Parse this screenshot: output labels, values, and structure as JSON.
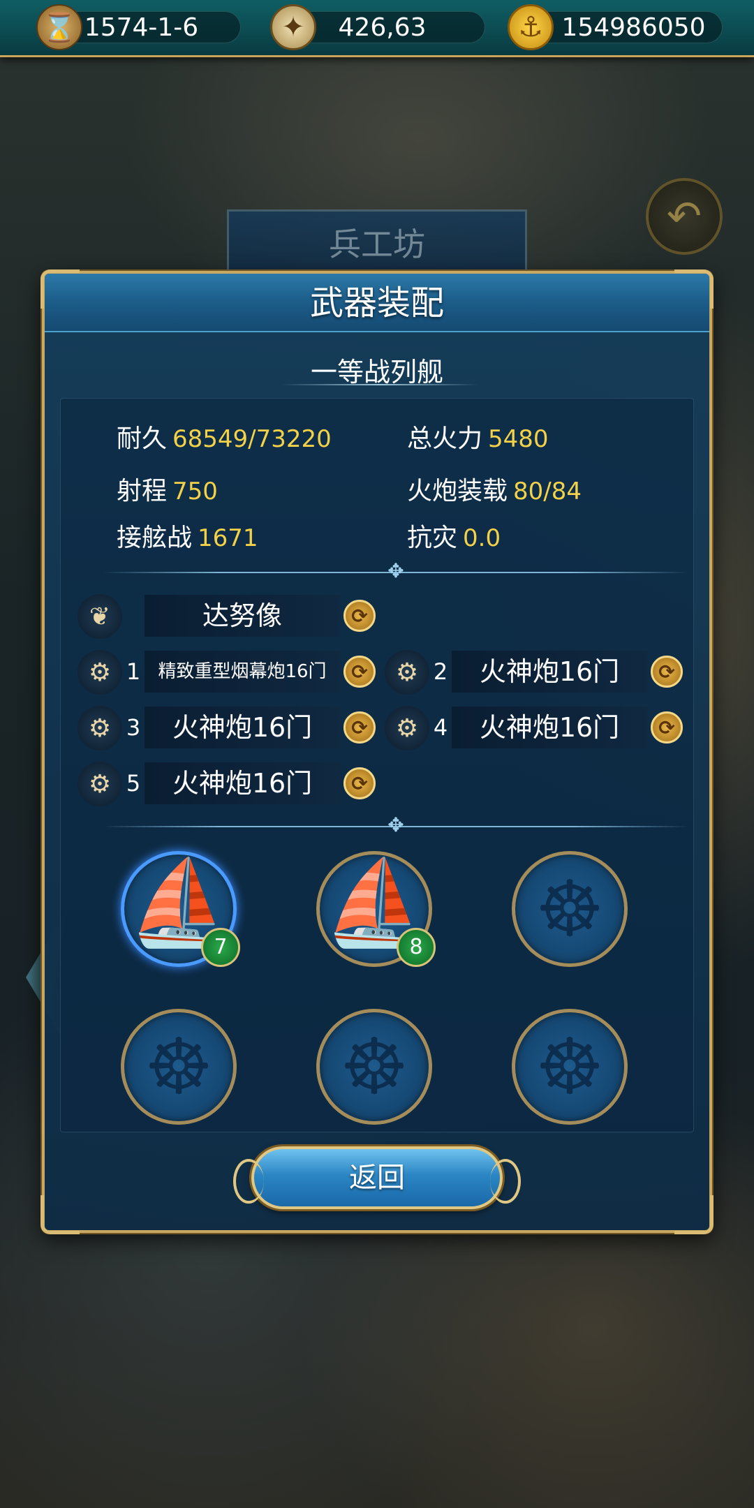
{
  "topbar": {
    "date": "1574-1-6",
    "coordinates": "426,63",
    "gold": "154986050",
    "icons": [
      "hourglass-icon",
      "compass-icon",
      "gold-coin-icon"
    ]
  },
  "background": {
    "title": "兵工坊"
  },
  "panel": {
    "title": "武器装配",
    "ship_name": "一等战列舰",
    "stats": [
      {
        "label": "耐久",
        "value": "68549/73220"
      },
      {
        "label": "总火力",
        "value": "5480"
      },
      {
        "label": "射程",
        "value": "750"
      },
      {
        "label": "火炮装载",
        "value": "80/84"
      },
      {
        "label": "接舷战",
        "value": "1671"
      },
      {
        "label": "抗灾",
        "value": "0.0"
      }
    ],
    "figurehead": {
      "label": "达努像",
      "icon": "wing-icon"
    },
    "cannons": [
      {
        "num": "1",
        "label": "精致重型烟幕炮16门"
      },
      {
        "num": "2",
        "label": "火神炮16门"
      },
      {
        "num": "3",
        "label": "火神炮16门"
      },
      {
        "num": "4",
        "label": "火神炮16门"
      },
      {
        "num": "5",
        "label": "火神炮16门"
      }
    ],
    "fleet": [
      {
        "level": "7",
        "occupied": true,
        "selected": true
      },
      {
        "level": "8",
        "occupied": true,
        "selected": false
      },
      {
        "occupied": false
      },
      {
        "occupied": false
      },
      {
        "occupied": false
      },
      {
        "occupied": false
      }
    ],
    "return_label": "返回"
  },
  "colors": {
    "accent_gold": "#c9a961",
    "value_yellow": "#f3d24a",
    "panel_blue": "#143e5c",
    "level_green": "#1a8a3a"
  }
}
